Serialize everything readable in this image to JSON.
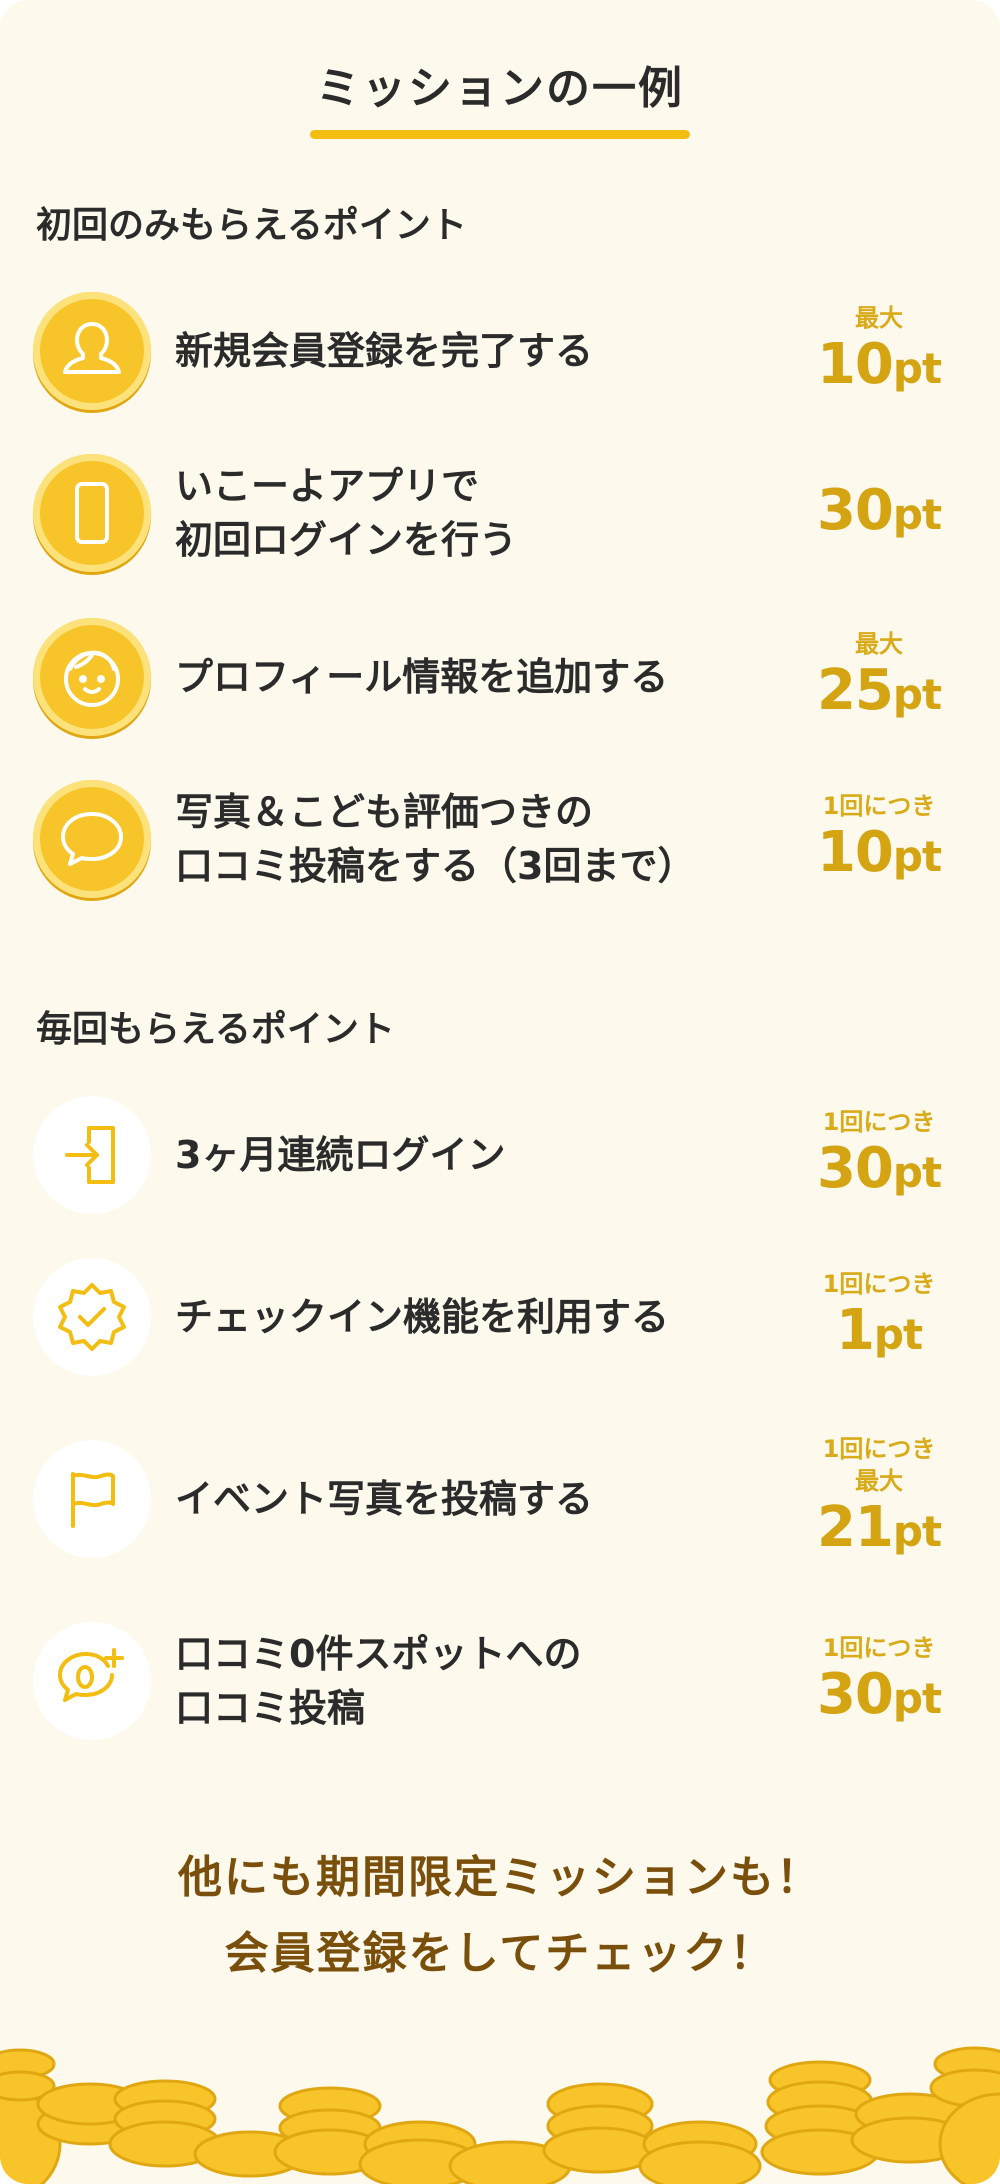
{
  "title": "ミッションの一例",
  "section1": {
    "title": "初回のみもらえるポイント",
    "items": [
      {
        "icon": "user-icon",
        "line1": "新規会員登録を完了する",
        "line2": "",
        "label1": "",
        "label2": "最大",
        "points": "10",
        "unit": "pt"
      },
      {
        "icon": "smartphone-icon",
        "line1": "いこーよアプリで",
        "line2": "初回ログインを行う",
        "label1": "",
        "label2": "",
        "points": "30",
        "unit": "pt"
      },
      {
        "icon": "child-face-icon",
        "line1": "プロフィール情報を追加する",
        "line2": "",
        "label1": "",
        "label2": "最大",
        "points": "25",
        "unit": "pt"
      },
      {
        "icon": "speech-bubble-icon",
        "line1": "写真＆こども評価つきの",
        "line2": "口コミ投稿をする（3回まで）",
        "label1": "",
        "label2": "1回につき",
        "points": "10",
        "unit": "pt"
      }
    ]
  },
  "section2": {
    "title": "毎回もらえるポイント",
    "items": [
      {
        "icon": "login-door-icon",
        "line1": "3ヶ月連続ログイン",
        "line2": "",
        "label1": "",
        "label2": "1回につき",
        "points": "30",
        "unit": "pt"
      },
      {
        "icon": "badge-check-icon",
        "line1": "チェックイン機能を利用する",
        "line2": "",
        "label1": "",
        "label2": "1回につき",
        "points": "1",
        "unit": "pt"
      },
      {
        "icon": "flag-icon",
        "line1": "イベント写真を投稿する",
        "line2": "",
        "label1": "1回につき",
        "label2": "最大",
        "points": "21",
        "unit": "pt"
      },
      {
        "icon": "zero-plus-bubble-icon",
        "line1": "口コミ0件スポットへの",
        "line2": "口コミ投稿",
        "label1": "",
        "label2": "1回につき",
        "points": "30",
        "unit": "pt"
      }
    ]
  },
  "cta": {
    "line1": "他にも期間限定ミッションも！",
    "line2": "会員登録をしてチェック！"
  },
  "colors": {
    "background": "#fdf9ec",
    "accent": "#f3bd12",
    "points": "#d4a413",
    "cta": "#7a4f0c",
    "coin": "#f7c52a"
  }
}
